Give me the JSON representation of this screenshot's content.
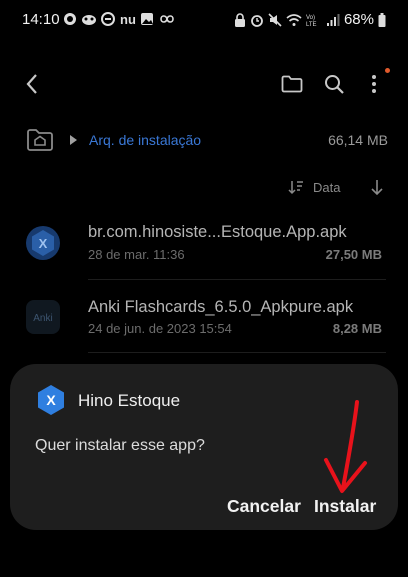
{
  "status_bar": {
    "time": "14:10",
    "battery_percent": "68%",
    "icons_left": [
      "chat-icon",
      "mask-icon",
      "link-icon",
      "nu-app-icon",
      "gallery-icon",
      "infinity-icon"
    ],
    "icons_right": [
      "lock-icon",
      "alarm-icon",
      "mute-icon",
      "wifi-icon",
      "volte-icon",
      "signal-icon",
      "battery-icon"
    ],
    "nu_text": "nu",
    "volte_text": "Vo) LTE"
  },
  "toolbar": {
    "icons": [
      "back-icon",
      "folder-icon",
      "search-icon",
      "more-options-icon"
    ]
  },
  "path": {
    "label": "Arq. de instalação",
    "size": "66,14 MB"
  },
  "sort": {
    "label": "Data"
  },
  "files": [
    {
      "name": "br.com.hinosiste...Estoque.App.apk",
      "date": "28 de mar. 11:36",
      "size": "27,50 MB",
      "icon_text": "X"
    },
    {
      "name": "Anki Flashcards_6.5.0_Apkpure.apk",
      "date": "24 de jun. de 2023 15:54",
      "size": "8,28 MB",
      "icon_text": "Anki"
    }
  ],
  "dialog": {
    "app_name": "Hino Estoque",
    "app_icon_text": "X",
    "question": "Quer instalar esse app?",
    "cancel_label": "Cancelar",
    "install_label": "Instalar"
  },
  "colors": {
    "accent_blue": "#3a78d6",
    "dialog_bg": "#1e1e1e",
    "annotation_red": "#e8121b"
  }
}
